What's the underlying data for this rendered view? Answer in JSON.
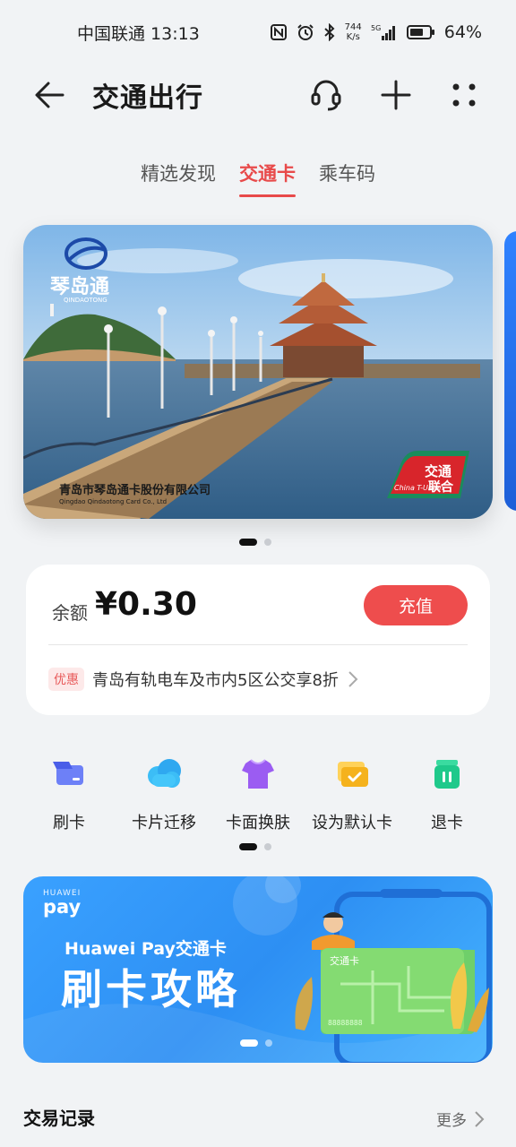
{
  "status_bar": {
    "carrier_time": "中国联通 13:13",
    "net_speed_value": "744",
    "net_speed_unit": "K/s",
    "signal": "5G",
    "battery": "64%"
  },
  "header": {
    "title": "交通出行"
  },
  "tabs": [
    {
      "label": "精选发现",
      "active": false
    },
    {
      "label": "交通卡",
      "active": true
    },
    {
      "label": "乘车码",
      "active": false
    }
  ],
  "card": {
    "brand_cn": "琴岛通",
    "brand_en": "QINDAOTONG",
    "issuer_cn": "青岛市琴岛通卡股份有限公司",
    "issuer_en": "Qingdao Qindaotong Card Co., Ltd",
    "union_cn": "交通联合",
    "union_en": "China T-Union",
    "carousel_page": 1,
    "carousel_total": 2
  },
  "balance": {
    "label": "余额",
    "value": "¥0.30",
    "recharge_label": "充值",
    "promo_badge": "优惠",
    "promo_text": "青岛有轨电车及市内5区公交享8折"
  },
  "actions": [
    {
      "label": "刷卡",
      "icon": "card-swipe-icon",
      "color": "#5b6ff5"
    },
    {
      "label": "卡片迁移",
      "icon": "cloud-transfer-icon",
      "color": "#2fb4f5"
    },
    {
      "label": "卡面换肤",
      "icon": "shirt-icon",
      "color": "#9a56f0"
    },
    {
      "label": "设为默认卡",
      "icon": "default-card-icon",
      "color": "#f5b21d"
    },
    {
      "label": "退卡",
      "icon": "trash-icon",
      "color": "#1fc98b"
    }
  ],
  "actions_pager": {
    "page": 1,
    "total": 2
  },
  "banner": {
    "brand_small": "HUAWEI",
    "brand_pay": "pay",
    "subtitle": "Huawei Pay交通卡",
    "title": "刷卡攻略",
    "card_label": "交通卡",
    "pager_page": 1,
    "pager_total": 2
  },
  "transactions": {
    "title": "交易记录",
    "more_label": "更多"
  }
}
